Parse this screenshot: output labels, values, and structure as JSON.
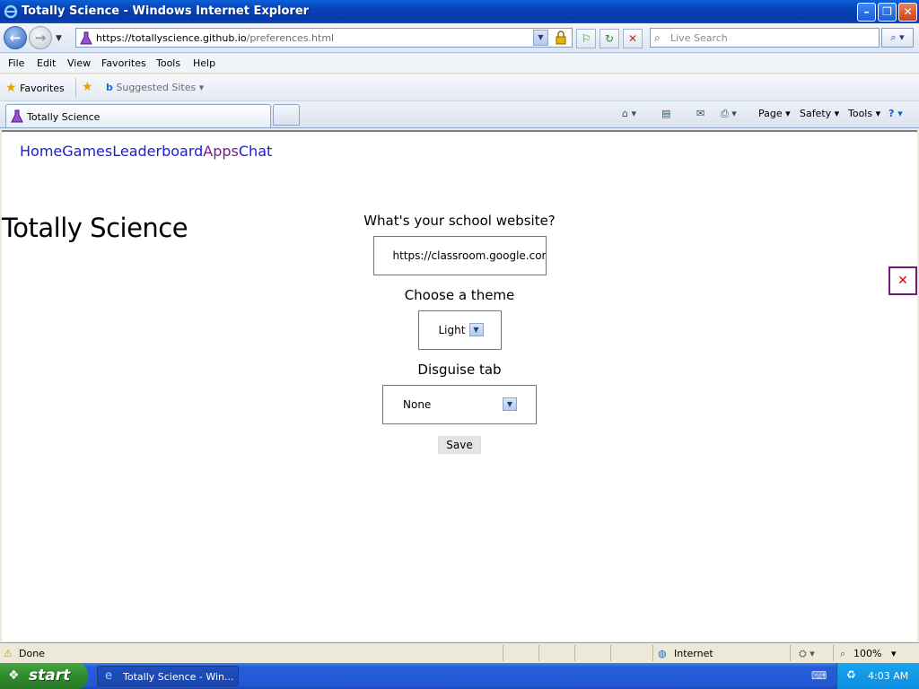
{
  "window": {
    "title": "Totally Science - Windows Internet Explorer",
    "minimize": "–",
    "restore": "❐",
    "close": "✕"
  },
  "toolbar": {
    "back": "←",
    "forward": "→",
    "history_dropdown": "▼",
    "url_host": "https://totallyscience.",
    "url_domain": "github.io",
    "url_path": "/preferences.html",
    "address_dropdown": "▼",
    "lock": "🔒",
    "compat": "⚐",
    "refresh": "↻",
    "stop": "✕",
    "search_placeholder": "Live Search",
    "search_icon": "⌕",
    "search_go": "⌕ ▾"
  },
  "menu": [
    "File",
    "Edit",
    "View",
    "Favorites",
    "Tools",
    "Help"
  ],
  "favorites_bar": {
    "favorites_label": "Favorites",
    "star": "★",
    "add_star": "★",
    "bing": "b",
    "suggested_sites": "Suggested Sites ▾"
  },
  "tabs": {
    "active_label": "Totally Science"
  },
  "command_bar": {
    "home": "⌂ ▾",
    "feeds": "▤",
    "mail": "✉",
    "print": "⎙ ▾",
    "page": "Page ▾",
    "safety": "Safety ▾",
    "tools": "Tools ▾",
    "help": "? ▾"
  },
  "page": {
    "nav": {
      "home": "Home",
      "games": "Games",
      "leaderboard": "Leaderboard",
      "apps": "Apps",
      "chat": "Chat"
    },
    "site_title": "Totally Science",
    "school_label": "What's your school website?",
    "school_value": "https://classroom.google.com",
    "theme_label": "Choose a theme",
    "theme_value": "Light",
    "disguise_label": "Disguise tab",
    "disguise_value": "None",
    "select_arrow": "▼",
    "save_label": "Save",
    "close_x": "✕"
  },
  "status_bar": {
    "status": "Done",
    "warning_icon": "⚠",
    "zone": "Internet",
    "globe": "◍",
    "protected": "⛭ ▾",
    "zoom": "100%",
    "zoom_icon": "⌕",
    "zoom_dropdown": "▾"
  },
  "taskbar": {
    "start_label": "start",
    "flag": "❖",
    "task_label": "Totally Science - Win...",
    "task_icon": "e",
    "kbd_icon": "⌨",
    "tray_icon": "♻",
    "clock": "4:03 AM"
  },
  "colors": {
    "link": "#1a1ae0",
    "visited_link": "#7a1a8c",
    "titlebar": "#0842b5",
    "start_green": "#2f8a2e"
  }
}
